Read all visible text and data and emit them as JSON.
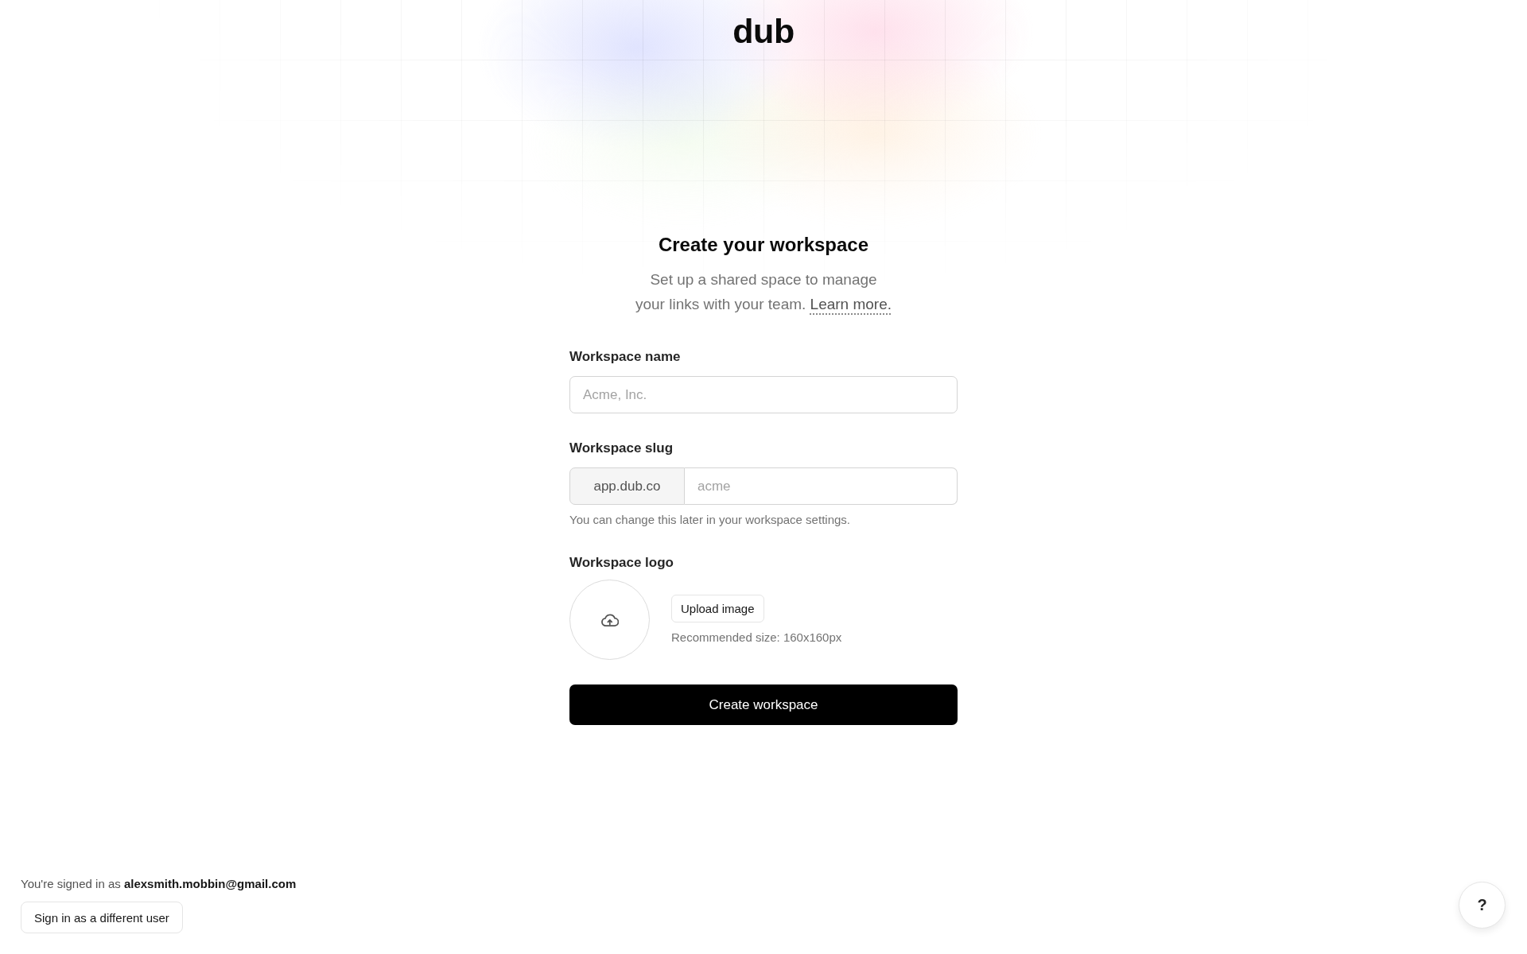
{
  "logo": "dub",
  "heading": "Create your workspace",
  "subtitle": {
    "text": "Set up a shared space to manage your links with your team.",
    "link": "Learn more."
  },
  "fields": [
    {
      "kind": "text",
      "label": "Workspace name",
      "placeholder": "Acme, Inc."
    },
    {
      "kind": "prefixed",
      "label": "Workspace slug",
      "prefix": "app.dub.co",
      "placeholder": "acme",
      "help": "You can change this later in your workspace settings."
    },
    {
      "kind": "image",
      "label": "Workspace logo",
      "button": "Upload image",
      "help": "Recommended size: 160x160px"
    }
  ],
  "submit_button": "Create workspace",
  "account": {
    "signed_in_text": "You're signed in as **alexsmith.mobbin@gmail.com**",
    "button": "Sign in as a different user"
  },
  "help_button": "?"
}
